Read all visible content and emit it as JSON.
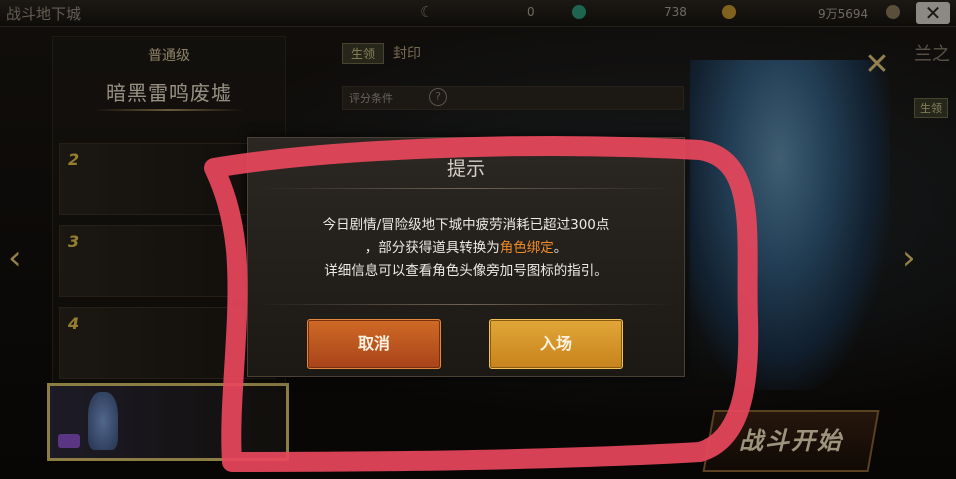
{
  "topbar": {
    "title": "战斗地下城",
    "moon_glyph": "☾",
    "value_a": "0",
    "value_b": "738",
    "value_c": "9万5694",
    "close_glyph": "✕"
  },
  "left_panel": {
    "tier": "普通级",
    "dungeon_name": "暗黑雷鸣废墟",
    "rows": [
      {
        "num": "2"
      },
      {
        "num": "3"
      },
      {
        "num": "4"
      }
    ],
    "star_glyph": "☆"
  },
  "right_panel": {
    "tag_normal": "生领",
    "tag_seal": "封印",
    "score_label": "评分条件",
    "question_glyph": "?",
    "side_tab": "兰之",
    "side_button": "生领"
  },
  "nav": {
    "left_glyph": "‹",
    "right_glyph": "›",
    "cross_glyph": "✕"
  },
  "start_button": {
    "label": "战斗开始"
  },
  "dialog": {
    "title": "提示",
    "line1": "今日剧情/冒险级地下城中疲劳消耗已超过300点",
    "line2_prefix": "，部分获得道具转换为",
    "line2_highlight": "角色绑定",
    "line2_suffix": "。",
    "line3": "详细信息可以查看角色头像旁加号图标的指引。",
    "cancel_label": "取消",
    "enter_label": "入场"
  },
  "colors": {
    "highlight_text": "#f08b2b",
    "annotation_red": "#e8475c",
    "cancel_button": "#c45a22",
    "enter_button": "#d8961f"
  }
}
